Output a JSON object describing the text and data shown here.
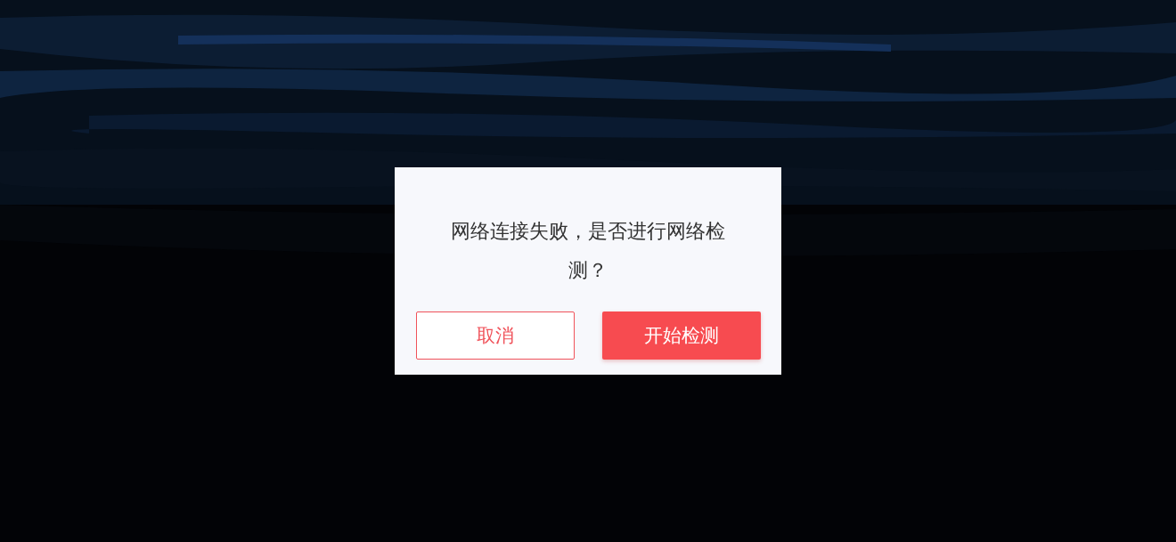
{
  "dialog": {
    "message": "网络连接失败，是否进行网络检测？",
    "buttons": [
      {
        "label": "取消",
        "kind": "secondary"
      },
      {
        "label": "开始检测",
        "kind": "primary"
      }
    ]
  }
}
